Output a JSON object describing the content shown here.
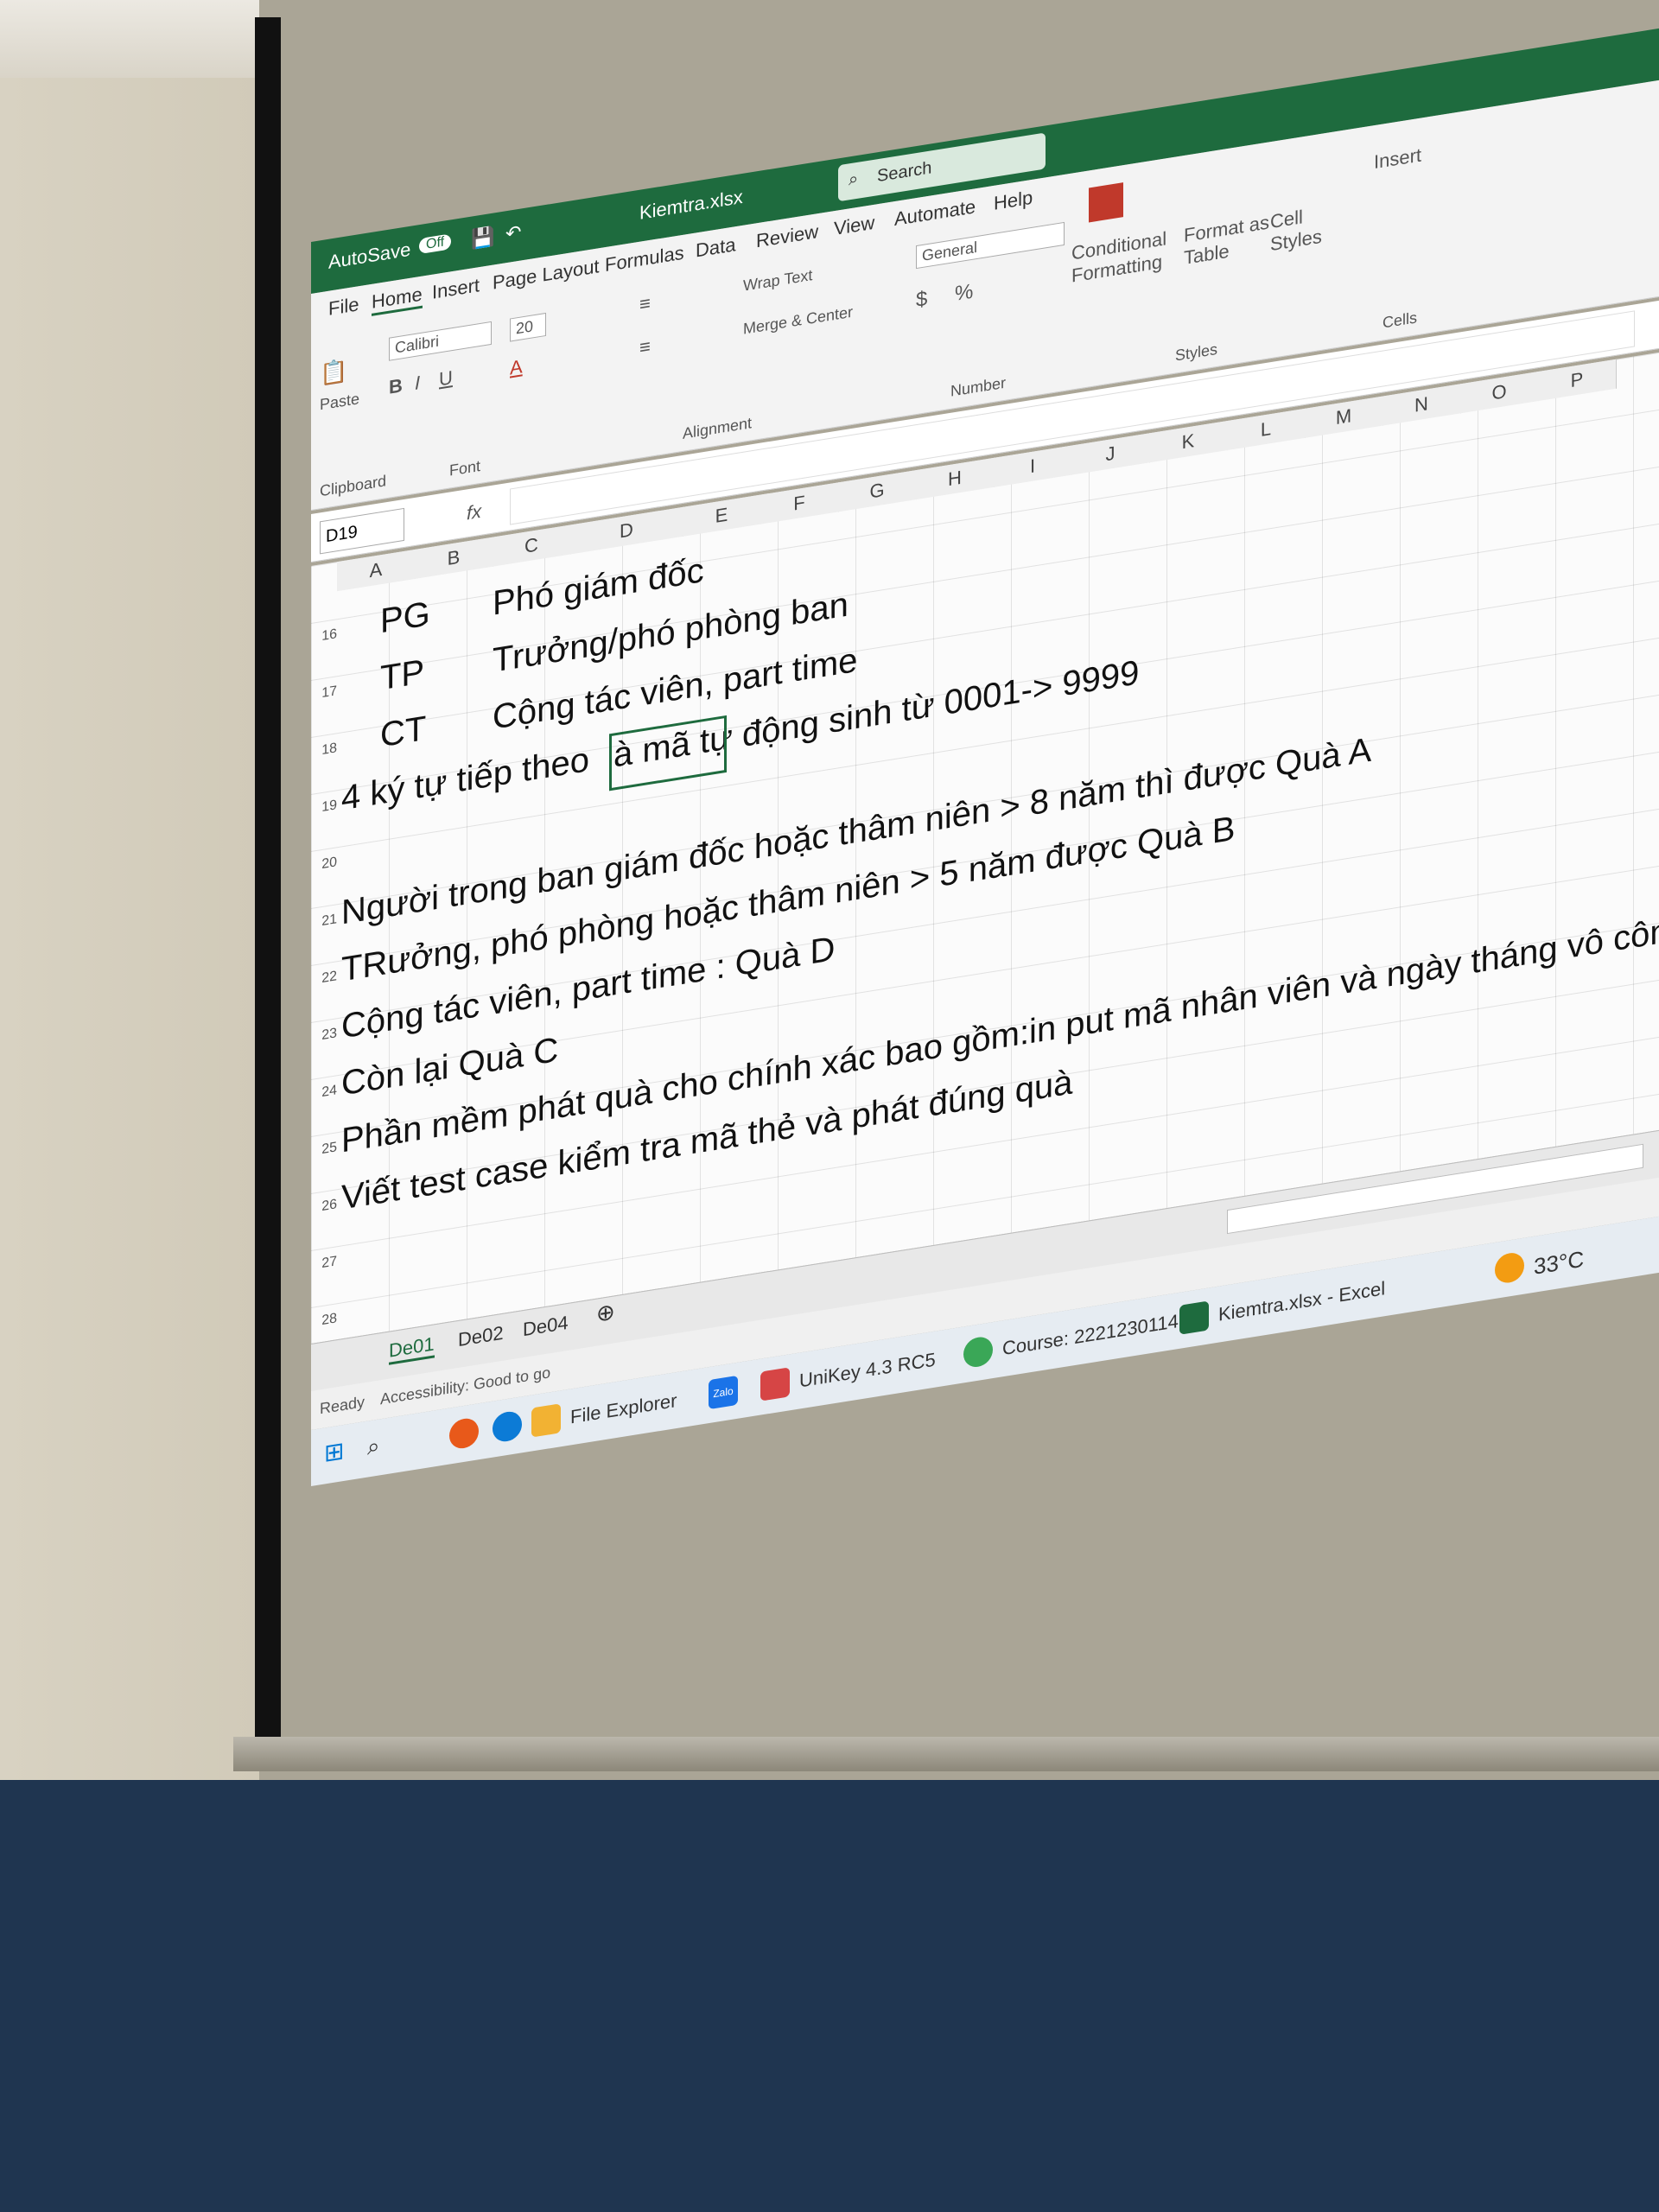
{
  "window": {
    "autosave_label": "AutoSave",
    "autosave_state": "Off",
    "file_name": "Kiemtra.xlsx",
    "search_placeholder": "Search"
  },
  "ribbon_tabs": [
    "File",
    "Home",
    "Insert",
    "Page Layout",
    "Formulas",
    "Data",
    "Review",
    "View",
    "Automate",
    "Help"
  ],
  "ribbon": {
    "clipboard_group": "Clipboard",
    "paste_label": "Paste",
    "font_name": "Calibri",
    "font_size": "20",
    "font_group": "Font",
    "wrap_text": "Wrap Text",
    "merge_center": "Merge & Center",
    "alignment_group": "Alignment",
    "number_format": "General",
    "number_group": "Number",
    "conditional_formatting": "Conditional Formatting",
    "format_as_table": "Format as Table",
    "cell_styles": "Cell Styles",
    "styles_group": "Styles",
    "insert_label": "Insert",
    "cells_group": "Cells"
  },
  "formula_bar": {
    "cell_ref": "D19",
    "fx_label": "fx"
  },
  "columns": [
    "A",
    "B",
    "C",
    "D",
    "E",
    "F",
    "G",
    "H",
    "I",
    "J",
    "K",
    "L",
    "M",
    "N",
    "O",
    "P"
  ],
  "rows": [
    {
      "num": "16",
      "b": "PG",
      "d": "Phó giám đốc"
    },
    {
      "num": "17",
      "b": "TP",
      "d": "Trưởng/phó phòng ban"
    },
    {
      "num": "18",
      "b": "CT",
      "d": "Cộng tác viên, part time"
    },
    {
      "num": "19",
      "a": "4 ký tự tiếp theo",
      "d": "à mã tự động sinh từ 0001-> 9999"
    },
    {
      "num": "20",
      "a": ""
    },
    {
      "num": "21",
      "a": "Người trong ban giám đốc hoặc thâm niên > 8 năm thì được Quà A"
    },
    {
      "num": "22",
      "a": "TRưởng, phó phòng hoặc thâm niên > 5 năm được Quà B"
    },
    {
      "num": "23",
      "a": "Cộng tác viên, part time : Quà D"
    },
    {
      "num": "24",
      "a": "Còn lại Quà C"
    },
    {
      "num": "25",
      "a": "Phần mềm phát quà cho chính xác bao gồm:in put mã nhân viên và ngày tháng vô công ty"
    },
    {
      "num": "26",
      "a": "Viết test case kiểm tra mã thẻ và phát đúng quà"
    },
    {
      "num": "27",
      "a": ""
    },
    {
      "num": "28",
      "a": ""
    }
  ],
  "sheet_tabs": [
    "De01",
    "De02",
    "De04"
  ],
  "status": {
    "ready": "Ready",
    "accessibility": "Accessibility: Good to go"
  },
  "taskbar": {
    "file_explorer": "File Explorer",
    "zalo": "Zalo",
    "unikey": "UniKey 4.3 RC5",
    "chrome": "Course: 2221230114...",
    "excel": "Kiemtra.xlsx - Excel",
    "weather": "33°C"
  },
  "colors": {
    "excel_green": "#1e6b3e",
    "conditional_formatting_red": "#c0392b"
  }
}
